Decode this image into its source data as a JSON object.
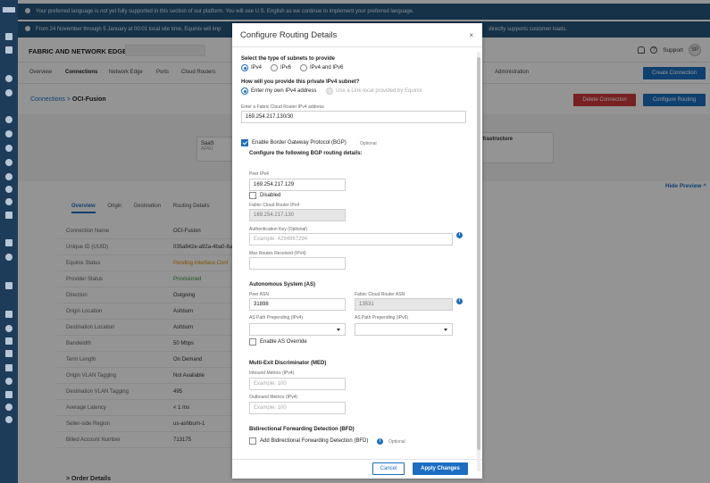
{
  "banners": [
    {
      "text": "Your preferred language is not yet fully supported in this section of our platform. You will see U.S. English as we continue to implement your preferred language."
    },
    {
      "text": "From 24 November through 5 January at 00:01 local site time, Equinix will imp",
      "text_right": "directly supports customer loads."
    }
  ],
  "app": {
    "brand": "FABRIC AND NETWORK EDGE",
    "support": "Support",
    "avatar": "SP"
  },
  "topnav": {
    "overview": "Overview",
    "connections": "Connections",
    "network_edge": "Network Edge",
    "ports": "Ports",
    "cloud_routers": "Cloud Routers",
    "administration": "Administration",
    "create_connection": "Create Connection"
  },
  "breadcrumb": {
    "parent": "Connections",
    "sep": ">",
    "current": "OCI-Fusion"
  },
  "actions": {
    "delete": "Delete Connection",
    "configure": "Configure Routing"
  },
  "topology": {
    "node_left": "SaaS",
    "node_left_sub": "APAI",
    "node_right": "Infrastructure"
  },
  "hide_preview": "Hide Preview",
  "detail_tabs": [
    "Overview",
    "Origin",
    "Destination",
    "Routing Details"
  ],
  "details": [
    {
      "label": "Connection Name",
      "value": "OCI-Fusion",
      "cls": ""
    },
    {
      "label": "Unique ID (UUID)",
      "value": "035a842e-a92a-4ba0-8a",
      "cls": ""
    },
    {
      "label": "Equinix Status",
      "value": "Pending Interface Conf",
      "cls": "warn"
    },
    {
      "label": "Provider Status",
      "value": "Provisioned",
      "cls": "ok"
    },
    {
      "label": "Direction",
      "value": "Outgoing",
      "cls": ""
    },
    {
      "label": "Origin Location",
      "value": "Ashburn",
      "cls": ""
    },
    {
      "label": "Destination Location",
      "value": "Ashburn",
      "cls": ""
    },
    {
      "label": "Bandwidth",
      "value": "50 Mbps",
      "cls": ""
    },
    {
      "label": "Term Length",
      "value": "On Demand",
      "cls": ""
    },
    {
      "label": "Origin VLAN Tagging",
      "value": "Not Available",
      "cls": ""
    },
    {
      "label": "Destination VLAN Tagging",
      "value": "495",
      "cls": ""
    },
    {
      "label": "Average Latency",
      "value": "< 1 ms",
      "cls": ""
    },
    {
      "label": "Seller-side Region",
      "value": "us-ashburn-1",
      "cls": ""
    },
    {
      "label": "Billed Account Number",
      "value": "713175",
      "cls": ""
    }
  ],
  "order_details": "Order Details",
  "modal": {
    "title": "Configure Routing Details",
    "close": "×",
    "subnet_type_label": "Select the type of subnets to provide",
    "subnet_types": [
      "IPv4",
      "IPv6",
      "IPv4 and IPv6"
    ],
    "provide_label": "How will you provide this private IPv4 subnet?",
    "provide_own": "Enter my own IPv4 address",
    "provide_linklocal": "Use a Link-local provided by Equinix",
    "fcr_ipv4_label": "Enter a Fabric Cloud Router IPv4 address",
    "fcr_ipv4_value": "169.254.217.130/30",
    "bgp_label": "Enable Border Gateway Protocol (BGP)",
    "optional": "Optional",
    "bgp_config_label": "Configure the following BGP routing details:",
    "peer_ipv4_label": "Peer IPv4",
    "peer_ipv4_value": "169.254.217.129",
    "disabled_label": "Disabled",
    "fcr_router_ipv4_label": "Fabric Cloud Router IPv4",
    "fcr_router_ipv4_value": "169.254.217.130",
    "auth_key_label": "Authentication Key (Optional)",
    "auth_key_placeholder": "Example: 4294967294",
    "max_routes_label": "Max Routes Received (IPv4)",
    "as_heading": "Autonomous System (AS)",
    "peer_asn_label": "Peer ASN",
    "peer_asn_value": "31898",
    "fcr_asn_label": "Fabric Cloud Router ASN",
    "fcr_asn_value": "13531",
    "as_prepend_v4_label": "AS Path Prepending (IPv4)",
    "as_prepend_v6_label": "AS Path Prepending (IPv6)",
    "as_override_label": "Enable AS Override",
    "med_heading": "Multi-Exit Discriminator (MED)",
    "inbound_label": "Inbound Metrics (IPv4)",
    "inbound_placeholder": "Example: 100",
    "outbound_label": "Outbound Metrics (IPv4)",
    "outbound_placeholder": "Example: 100",
    "bfd_heading": "Bidirectional Forwarding Detection (BFD)",
    "bfd_label": "Add Bidirectional Forwarding Detection (BFD)",
    "cancel": "Cancel",
    "apply": "Apply Changes"
  }
}
